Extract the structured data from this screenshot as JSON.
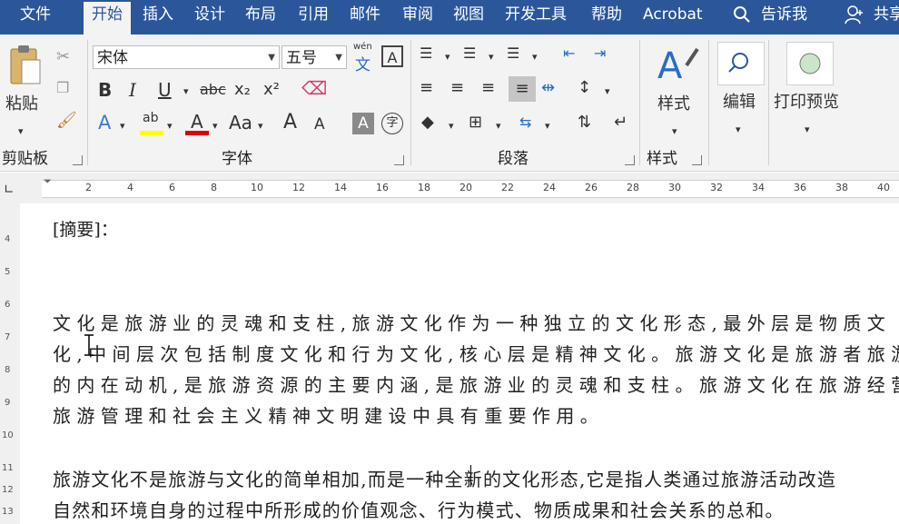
{
  "tabs": {
    "file": "文件",
    "home": "开始",
    "insert": "插入",
    "design": "设计",
    "layout": "布局",
    "references": "引用",
    "mailings": "邮件",
    "review": "审阅",
    "view": "视图",
    "developer": "开发工具",
    "help": "帮助",
    "acrobat": "Acrobat",
    "tellme": "告诉我",
    "share": "共享"
  },
  "clipboard": {
    "paste_label": "粘贴",
    "group_label": "剪贴板"
  },
  "font": {
    "font_name": "宋体",
    "font_size": "五号",
    "group_label": "字体",
    "wen_label": "wén",
    "wen_char": "文",
    "boxed_a": "A",
    "bold": "B",
    "italic": "I",
    "underline": "U",
    "strike": "abc",
    "subscript": "x₂",
    "superscript": "x²",
    "text_effect": "A",
    "highlight": "ab",
    "font_color": "A",
    "change_case": "Aa",
    "grow": "A",
    "shrink": "A",
    "char_shading": "A",
    "enclose": "字"
  },
  "paragraph": {
    "group_label": "段落"
  },
  "styles": {
    "styles_label": "样式",
    "group_label": "样式"
  },
  "editing": {
    "label": "编辑"
  },
  "print_preview": {
    "label": "打印预览"
  },
  "ruler": {
    "marks": [
      "2",
      "4",
      "6",
      "8",
      "10",
      "12",
      "14",
      "16",
      "18",
      "20",
      "22",
      "24",
      "26",
      "28",
      "30",
      "32",
      "34",
      "36",
      "38",
      "40"
    ],
    "vmarks": [
      "4",
      "5",
      "6",
      "7",
      "8",
      "9",
      "10",
      "11",
      "12",
      "13"
    ]
  },
  "document": {
    "heading": "[摘要]：",
    "para1_lines": [
      "文化是旅游业的灵魂和支柱,旅游文化作为一种独立的文化形态,最外层是物质文",
      "化,中间层次包括制度文化和行为文化,核心层是精神文化。旅游文化是旅游者旅游",
      "的内在动机,是旅游资源的主要内涵,是旅游业的灵魂和支柱。旅游文化在旅游经营",
      "旅游管理和社会主义精神文明建设中具有重要作用。"
    ],
    "para2_lines": [
      "旅游文化不是旅游与文化的简单相加,而是一种全新的文化形态,它是指人类通过旅游活动改造",
      "自然和环境自身的过程中所形成的价值观念、行为模式、物质成果和社会关系的总和。"
    ]
  },
  "colors": {
    "tab_bar": "#2b579a",
    "ribbon": "#f3f3f3",
    "highlight_yellow": "#ffff00",
    "font_red": "#e00000",
    "accent_blue": "#2b6cc4"
  }
}
